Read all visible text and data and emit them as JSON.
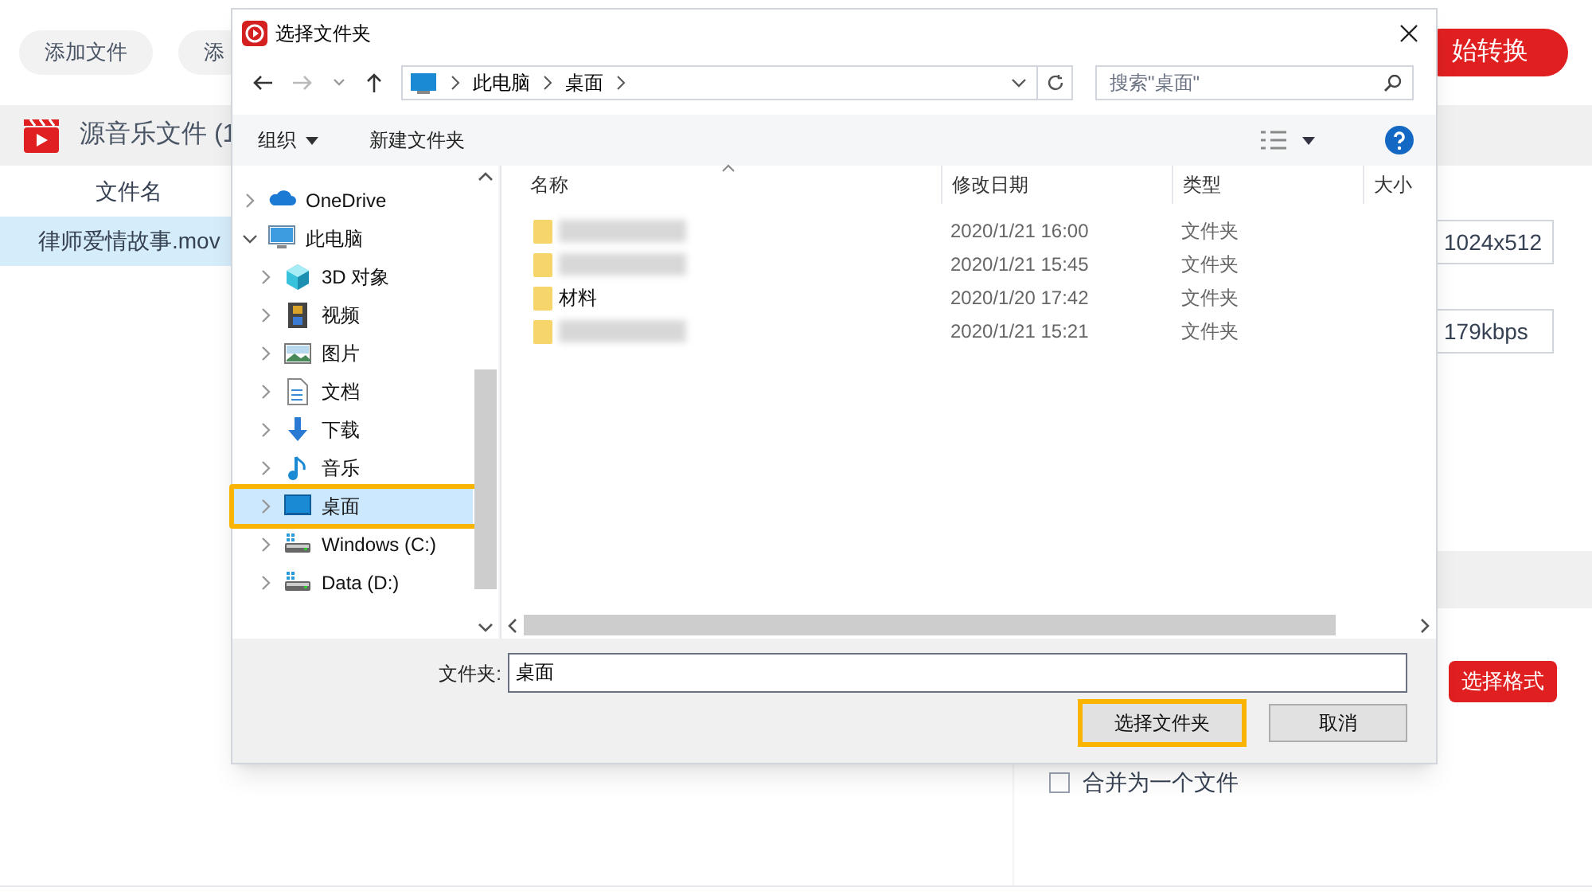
{
  "app": {
    "toolbar_buttons": [
      "添加文件",
      "添"
    ],
    "start_button": "始转换",
    "source_header": "源音乐文件 (1",
    "file_column": "文件名",
    "files": [
      {
        "name": "律师爱情故事.mov",
        "selected": true
      }
    ],
    "resolution": "1024x512",
    "bitrate": "179kbps",
    "format_button": "选择格式",
    "merge": {
      "label": "合并为一个文件",
      "checked": false
    }
  },
  "dialog": {
    "title": "选择文件夹",
    "breadcrumb": [
      "此电脑",
      "桌面"
    ],
    "search": {
      "placeholder": "搜索\"桌面\""
    },
    "toolbar": [
      "组织",
      "新建文件夹"
    ],
    "tree": [
      {
        "kind": "cloud",
        "label": "OneDrive",
        "expanded": false,
        "selected": false
      },
      {
        "kind": "pc",
        "label": "此电脑",
        "expanded": true,
        "selected": false,
        "children": [
          {
            "kind": "cube",
            "label": "3D 对象",
            "expanded": false,
            "selected": false
          },
          {
            "kind": "film",
            "label": "视频",
            "expanded": false,
            "selected": false
          },
          {
            "kind": "image",
            "label": "图片",
            "expanded": false,
            "selected": false
          },
          {
            "kind": "doc",
            "label": "文档",
            "expanded": false,
            "selected": false
          },
          {
            "kind": "download",
            "label": "下载",
            "expanded": false,
            "selected": false
          },
          {
            "kind": "music",
            "label": "音乐",
            "expanded": false,
            "selected": false
          },
          {
            "kind": "desktop",
            "label": "桌面",
            "expanded": false,
            "selected": true,
            "highlighted": true
          },
          {
            "kind": "drive",
            "label": "Windows (C:)",
            "expanded": false,
            "selected": false
          },
          {
            "kind": "drive",
            "label": "Data (D:)",
            "expanded": false,
            "selected": false
          }
        ]
      }
    ],
    "columns": [
      "名称",
      "修改日期",
      "类型",
      "大小"
    ],
    "rows": [
      {
        "blurred": true,
        "modified": "2020/1/21 16:00",
        "type": "文件夹"
      },
      {
        "blurred": true,
        "modified": "2020/1/21 15:45",
        "type": "文件夹"
      },
      {
        "blurred": false,
        "name": "材料",
        "modified": "2020/1/20 17:42",
        "type": "文件夹"
      },
      {
        "blurred": true,
        "modified": "2020/1/21 15:21",
        "type": "文件夹"
      }
    ],
    "folder_label": "文件夹:",
    "folder_value": "桌面",
    "buttons": [
      {
        "label": "选择文件夹",
        "highlighted": true
      },
      {
        "label": "取消",
        "highlighted": false
      }
    ]
  }
}
